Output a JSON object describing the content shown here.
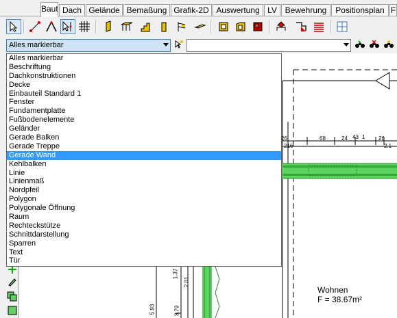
{
  "tabs": [
    {
      "label": "Bauteile",
      "active": true
    },
    {
      "label": "Dach",
      "active": false
    },
    {
      "label": "Gelände",
      "active": false
    },
    {
      "label": "Bemaßung",
      "active": false
    },
    {
      "label": "Grafik-2D",
      "active": false
    },
    {
      "label": "Auswertung",
      "active": false
    },
    {
      "label": "LV",
      "active": false
    },
    {
      "label": "Bewehrung",
      "active": false
    },
    {
      "label": "Positionsplan",
      "active": false
    },
    {
      "label": "F",
      "active": false
    }
  ],
  "filter": {
    "selected_value": "Alles markierbar",
    "second_value": ""
  },
  "dropdown": {
    "items": [
      "Alles markierbar",
      "Beschriftung",
      "Dachkonstruktionen",
      "Decke",
      "Einbauteil Standard 1",
      "Fenster",
      "Fundamentplatte",
      "Fußbodenelemente",
      "Geländer",
      "Gerade Balken",
      "Gerade Treppe",
      "Gerade Wand",
      "Kehlbalken",
      "Linie",
      "Linienmaß",
      "Nordpfeil",
      "Polygon",
      "Polygonale Öffnung",
      "Raum",
      "Rechteckstütze",
      "Schnittdarstellung",
      "Sparren",
      "Text",
      "Tür"
    ],
    "highlighted": "Gerade Wand"
  },
  "drawing": {
    "dim_labels": [
      "26",
      "216",
      "68",
      "24",
      "43",
      "1",
      "26",
      "2.1",
      "2.1"
    ],
    "vertical_labels": [
      "1.37",
      "2.01",
      "5.93",
      "3.79"
    ],
    "room_name": "Wohnen",
    "room_area": "F = 38.67m²"
  },
  "colors": {
    "selection": "#3399ff",
    "wall_green": "#5fd35f",
    "tab_border": "#a0a0a0"
  }
}
